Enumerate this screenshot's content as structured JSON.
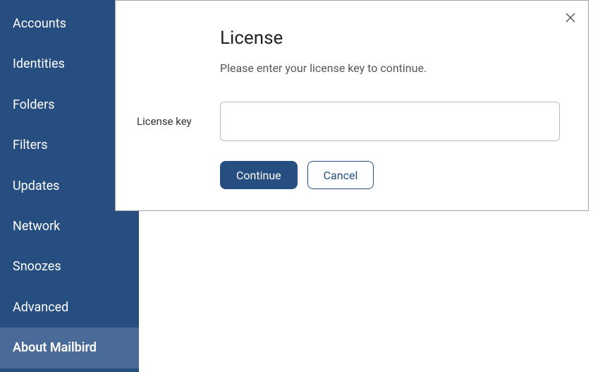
{
  "sidebar": {
    "items": [
      {
        "label": "Accounts",
        "active": false
      },
      {
        "label": "Identities",
        "active": false
      },
      {
        "label": "Folders",
        "active": false
      },
      {
        "label": "Filters",
        "active": false
      },
      {
        "label": "Updates",
        "active": false
      },
      {
        "label": "Network",
        "active": false
      },
      {
        "label": "Snoozes",
        "active": false
      },
      {
        "label": "Advanced",
        "active": false
      },
      {
        "label": "About Mailbird",
        "active": true
      }
    ]
  },
  "dialog": {
    "title": "License",
    "description": "Please enter your license key to continue.",
    "field_label": "License key",
    "field_value": "",
    "primary_button": "Continue",
    "secondary_button": "Cancel"
  }
}
